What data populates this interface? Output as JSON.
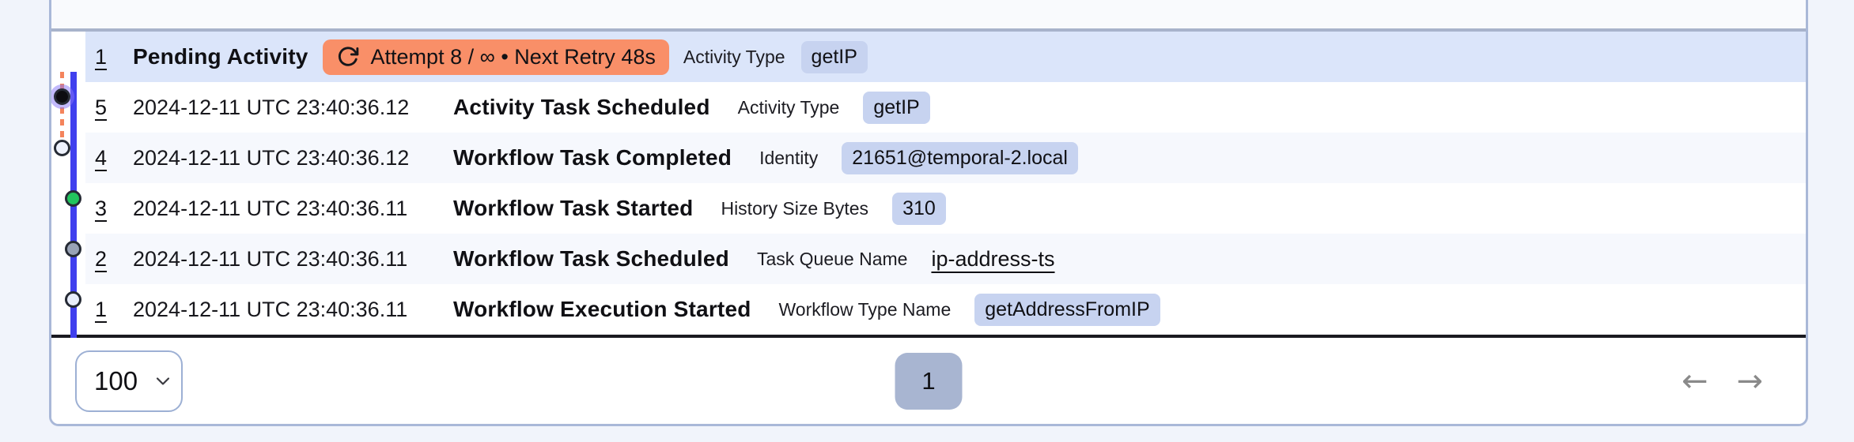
{
  "pending_row": {
    "number": "1",
    "title": "Pending Activity",
    "retry_badge_text": "Attempt 8 / ∞ • Next Retry 48s",
    "retry_icon": "retry-circular-arrow",
    "attr_label": "Activity Type",
    "attr_value": "getIP"
  },
  "events": [
    {
      "id": "5",
      "time": "2024-12-11 UTC 23:40:36.12",
      "name": "Activity Task Scheduled",
      "attr_label": "Activity Type",
      "attr_value": "getIP",
      "dot": "hollow"
    },
    {
      "id": "4",
      "time": "2024-12-11 UTC 23:40:36.12",
      "name": "Workflow Task Completed",
      "attr_label": "Identity",
      "attr_value": "21651@temporal-2.local",
      "dot": "green"
    },
    {
      "id": "3",
      "time": "2024-12-11 UTC 23:40:36.11",
      "name": "Workflow Task Started",
      "attr_label": "History Size Bytes",
      "attr_value": "310",
      "dot": "gray"
    },
    {
      "id": "2",
      "time": "2024-12-11 UTC 23:40:36.11",
      "name": "Workflow Task Scheduled",
      "attr_label": "Task Queue Name",
      "attr_value": "ip-address-ts",
      "dot": "hollow"
    },
    {
      "id": "1",
      "time": "2024-12-11 UTC 23:40:36.11",
      "name": "Workflow Execution Started",
      "attr_label": "Workflow Type Name",
      "attr_value": "getAddressFromIP",
      "dot": "gray"
    }
  ],
  "pagination": {
    "per_page": "100",
    "current_page": "1",
    "prev_icon": "←",
    "next_icon": "→"
  },
  "colors": {
    "selected_row_bg": "#dbe5fa",
    "alt_row_bg": "#f6f8fd",
    "retry_badge_bg": "#f98f68",
    "attr_badge_bg": "#c7d3f0",
    "timeline_blue": "#4040ee",
    "timeline_orange_dash": "#f4845c",
    "green_dot": "#22c55e",
    "gray_dot": "#99a3b6",
    "page_button_bg": "#a8b5d1",
    "panel_border": "#a9b8d8"
  }
}
